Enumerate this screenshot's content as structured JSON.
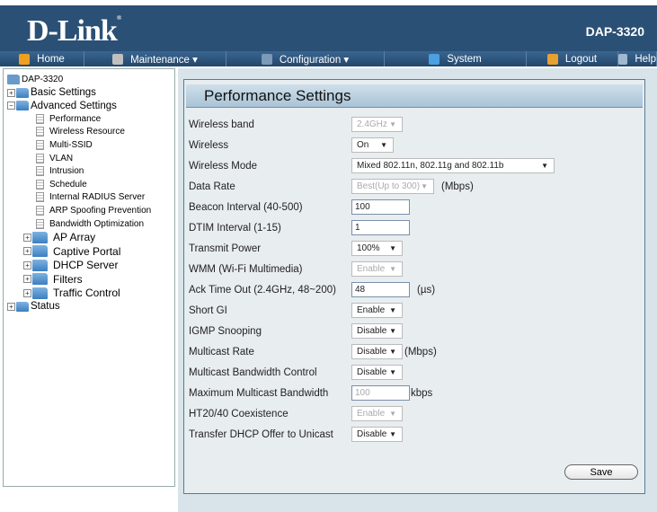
{
  "header": {
    "logo": "D-Link",
    "model": "DAP-3320"
  },
  "nav": [
    {
      "label": "Home",
      "icon": "home-icon",
      "color": "#f0a020"
    },
    {
      "label": "Maintenance ▾",
      "icon": "tools-icon",
      "color": "#c0c0c0"
    },
    {
      "label": "Configuration ▾",
      "icon": "floppy-icon",
      "color": "#7a9ab8"
    },
    {
      "label": "System",
      "icon": "globe-icon",
      "color": "#4aa0e0"
    },
    {
      "label": "Logout",
      "icon": "key-icon",
      "color": "#e8a030"
    },
    {
      "label": "Help",
      "icon": "help-icon",
      "color": "#a0b8d0"
    }
  ],
  "tree": {
    "root": "DAP-3320",
    "basic": "Basic Settings",
    "advanced": "Advanced Settings",
    "pages": [
      "Performance",
      "Wireless Resource",
      "Multi-SSID",
      "VLAN",
      "Intrusion",
      "Schedule",
      "Internal RADIUS Server",
      "ARP Spoofing Prevention",
      "Bandwidth Optimization"
    ],
    "folders": [
      "AP Array",
      "Captive Portal",
      "DHCP Server",
      "Filters",
      "Traffic Control"
    ],
    "status": "Status"
  },
  "panel": {
    "title": "Performance Settings",
    "rows": [
      {
        "label": "Wireless band",
        "value": "2.4GHz",
        "type": "select",
        "disabled": true
      },
      {
        "label": "Wireless",
        "value": "On",
        "type": "select"
      },
      {
        "label": "Wireless Mode",
        "value": "Mixed 802.11n, 802.11g and 802.11b",
        "type": "select"
      },
      {
        "label": "Data Rate",
        "value": "Best(Up to 300)",
        "type": "select",
        "disabled": true,
        "unit": "(Mbps)"
      },
      {
        "label": "Beacon Interval (40-500)",
        "value": "100",
        "type": "input"
      },
      {
        "label": "DTIM Interval (1-15)",
        "value": "1",
        "type": "input"
      },
      {
        "label": "Transmit Power",
        "value": "100%",
        "type": "select"
      },
      {
        "label": "WMM (Wi-Fi Multimedia)",
        "value": "Enable",
        "type": "select",
        "disabled": true
      },
      {
        "label": "Ack Time Out (2.4GHz, 48~200)",
        "value": "48",
        "type": "input",
        "unit": "(µs)"
      },
      {
        "label": "Short GI",
        "value": "Enable",
        "type": "select"
      },
      {
        "label": "IGMP Snooping",
        "value": "Disable",
        "type": "select"
      },
      {
        "label": "Multicast Rate",
        "value": "Disable",
        "type": "select",
        "unit": "(Mbps)"
      },
      {
        "label": "Multicast Bandwidth Control",
        "value": "Disable",
        "type": "select"
      },
      {
        "label": "Maximum Multicast Bandwidth",
        "value": "100",
        "type": "input",
        "disabled": true,
        "unit": "kbps"
      },
      {
        "label": "HT20/40 Coexistence",
        "value": "Enable",
        "type": "select",
        "disabled": true
      },
      {
        "label": "Transfer DHCP Offer to Unicast",
        "value": "Disable",
        "type": "select"
      }
    ],
    "save_label": "Save"
  }
}
